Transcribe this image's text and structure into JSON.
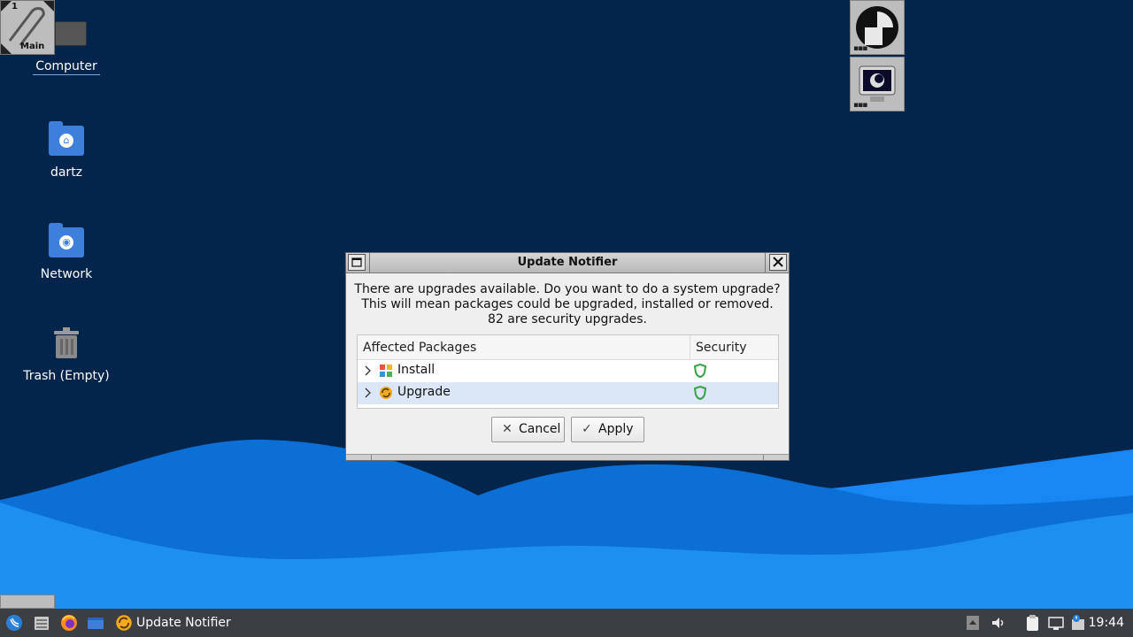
{
  "desktop": {
    "icons": [
      {
        "label": "Computer"
      },
      {
        "label": "dartz"
      },
      {
        "label": "Network"
      },
      {
        "label": "Trash (Empty)"
      }
    ],
    "wm_clip": {
      "workspace_number": "1",
      "workspace_name": "Main"
    }
  },
  "dialog": {
    "title": "Update Notifier",
    "message_line1": "There are upgrades available. Do you want to do a system upgrade?",
    "message_line2": "This will mean packages could be upgraded, installed or removed.",
    "message_line3": "82 are security upgrades.",
    "columns": {
      "packages": "Affected Packages",
      "security": "Security"
    },
    "rows": [
      {
        "label": "Install",
        "icon": "install-icon",
        "security": "shield-icon"
      },
      {
        "label": "Upgrade",
        "icon": "upgrade-icon",
        "security": "shield-icon",
        "selected": true
      }
    ],
    "buttons": {
      "cancel": "Cancel",
      "apply": "Apply"
    }
  },
  "taskbar": {
    "task_label": "Update Notifier",
    "clock": "19:44"
  },
  "colors": {
    "desktop_bg": "#03254c",
    "wave_light": "#1e90ff",
    "accent_blue": "#3f7fdc",
    "shield_green": "#3aa04a",
    "taskbar_bg": "#3b3f44"
  }
}
